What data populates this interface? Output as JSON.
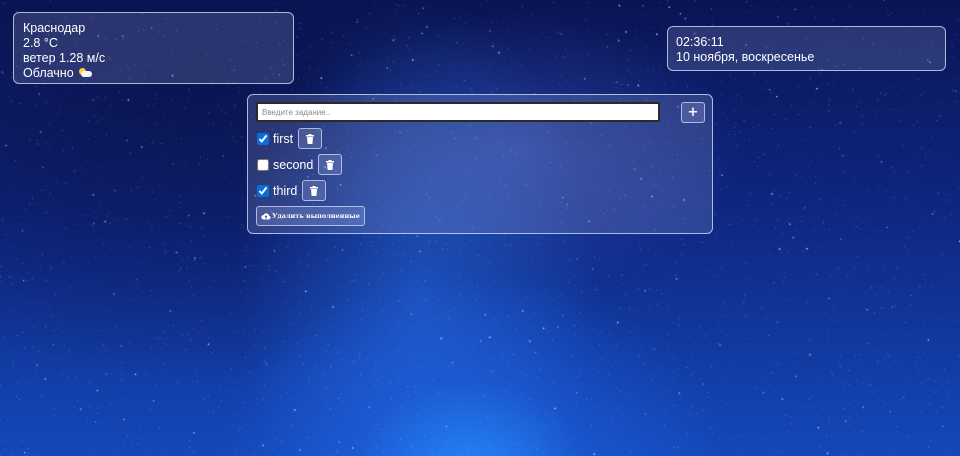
{
  "weather": {
    "city": "Краснодар",
    "temperature": "2.8 °C",
    "wind": "ветер 1.28 м/с",
    "condition": "Облачно",
    "condition_icon": "sun-behind-cloud-icon"
  },
  "clock": {
    "time": "02:36:11",
    "date": "10 ноября, воскресенье"
  },
  "todo": {
    "input_placeholder": "Введите задание..",
    "add_label": "+",
    "tasks": [
      {
        "label": "first",
        "done": true
      },
      {
        "label": "second",
        "done": false
      },
      {
        "label": "third",
        "done": true
      }
    ],
    "delete_icon": "trash-icon",
    "clear_label": "Удалить выполненные",
    "clear_icon": "cloud-upload-icon"
  },
  "colors": {
    "panel_border": "#dce1ff",
    "checkbox_accent": "#0a6cd9",
    "background_top": "#0a1454",
    "background_bottom": "#1448b8"
  }
}
